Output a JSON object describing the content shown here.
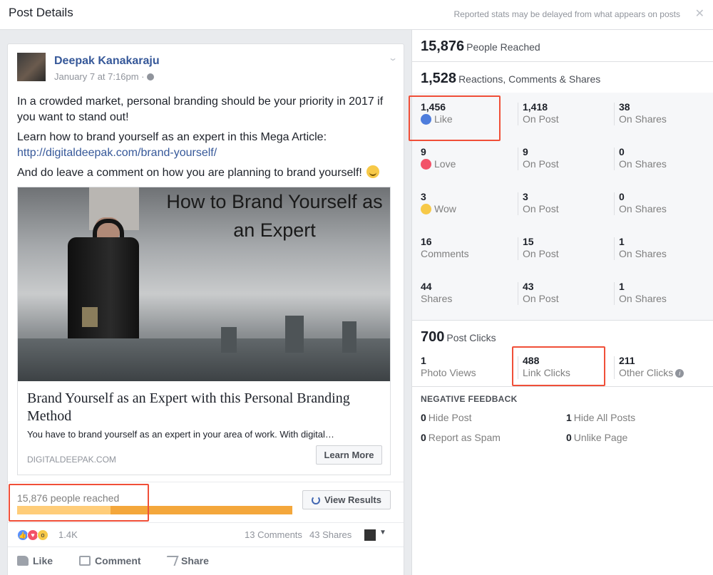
{
  "header": {
    "title": "Post Details",
    "note": "Reported stats may be delayed from what appears on posts",
    "close": "✕"
  },
  "post": {
    "author": "Deepak Kanakaraju",
    "date": "January 7 at 7:16pm ·",
    "text1": "In a crowded market, personal branding should be your priority in 2017 if you want to stand out!",
    "text2": "Learn how to brand yourself as an expert in this Mega Article:",
    "link": "http://digitaldeepak.com/brand-yourself/",
    "text3": "And do leave a comment on how you are planning to brand yourself!",
    "preview": {
      "image_title": "How to Brand Yourself as an Expert",
      "headline": "Brand Yourself as an Expert with this Personal Branding Method",
      "description": "You have to brand yourself as an expert in your area of work. With digital…",
      "domain": "DIGITALDEEPAK.COM",
      "cta": "Learn More"
    },
    "reach": {
      "label": "15,876 people reached",
      "fraction": 0.34,
      "button": "View Results"
    },
    "reactions_count": "1.4K",
    "comments": "13 Comments",
    "shares": "43 Shares",
    "actions": {
      "like": "Like",
      "comment": "Comment",
      "share": "Share"
    }
  },
  "stats": {
    "people_reached": {
      "value": "15,876",
      "label": "People Reached"
    },
    "engagement": {
      "value": "1,528",
      "label": "Reactions, Comments & Shares"
    },
    "rows": [
      {
        "total": "1,456",
        "label": "Like",
        "icon": "like-icon",
        "on_post": "1,418",
        "on_shares": "38"
      },
      {
        "total": "9",
        "label": "Love",
        "icon": "love-icon",
        "on_post": "9",
        "on_shares": "0"
      },
      {
        "total": "3",
        "label": "Wow",
        "icon": "wow-icon",
        "on_post": "3",
        "on_shares": "0"
      },
      {
        "total": "16",
        "label": "Comments",
        "on_post": "15",
        "on_shares": "1"
      },
      {
        "total": "44",
        "label": "Shares",
        "on_post": "43",
        "on_shares": "1"
      }
    ],
    "on_post_label": "On Post",
    "on_shares_label": "On Shares",
    "post_clicks": {
      "value": "700",
      "label": "Post Clicks"
    },
    "clicks": [
      {
        "value": "1",
        "label": "Photo Views"
      },
      {
        "value": "488",
        "label": "Link Clicks"
      },
      {
        "value": "211",
        "label": "Other Clicks"
      }
    ],
    "negative_title": "NEGATIVE FEEDBACK",
    "negative": [
      {
        "value": "0",
        "label": "Hide Post"
      },
      {
        "value": "1",
        "label": "Hide All Posts"
      },
      {
        "value": "0",
        "label": "Report as Spam"
      },
      {
        "value": "0",
        "label": "Unlike Page"
      }
    ]
  },
  "colors": {
    "highlight": "#f04f38",
    "link": "#365899",
    "reach_bar": "#f4a73b",
    "reach_fill": "#ffcd79"
  }
}
